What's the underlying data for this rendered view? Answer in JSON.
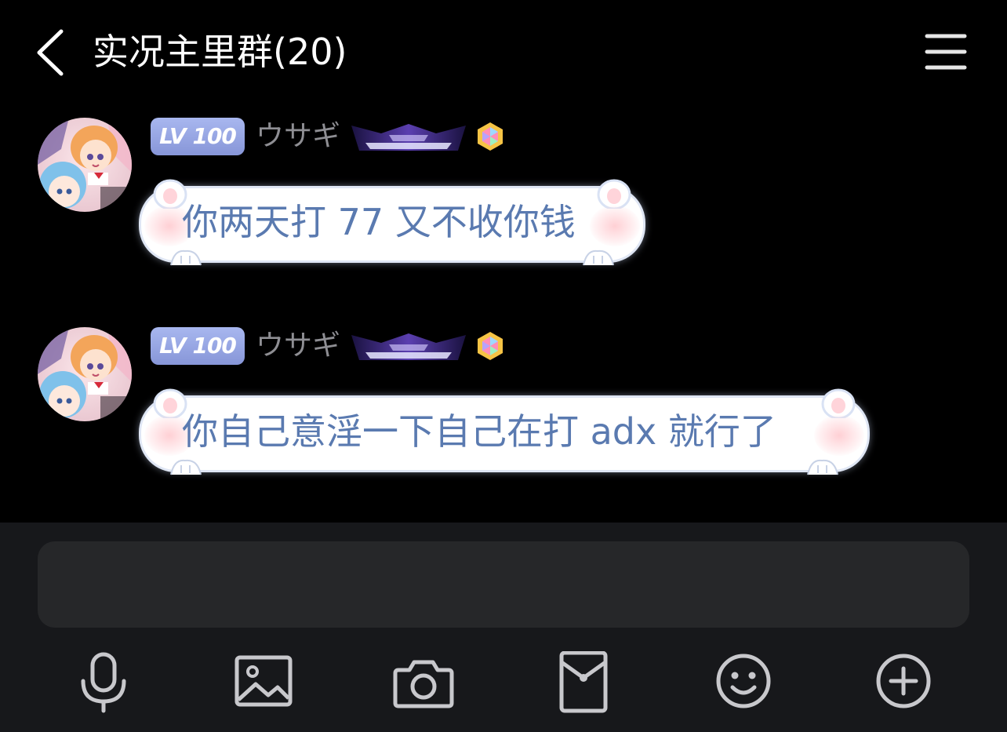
{
  "header": {
    "title": "实况主里群(20)",
    "back_icon": "chevron-left-icon",
    "menu_icon": "hamburger-menu-icon"
  },
  "messages": [
    {
      "level_badge": "LV 100",
      "username": "ウサギ",
      "text": "你两天打 77 又不收你钱"
    },
    {
      "level_badge": "LV 100",
      "username": "ウサギ",
      "text": "你自己意淫一下自己在打 adx 就行了"
    }
  ],
  "input": {
    "placeholder": ""
  },
  "toolbar": [
    {
      "icon": "microphone-icon"
    },
    {
      "icon": "image-icon"
    },
    {
      "icon": "camera-icon"
    },
    {
      "icon": "red-packet-icon"
    },
    {
      "icon": "emoji-icon"
    },
    {
      "icon": "plus-icon"
    }
  ],
  "colors": {
    "background": "#000000",
    "panel": "#17181b",
    "input": "#262729",
    "bubble_text": "#5a7ab0",
    "username": "#8e8e93",
    "badge": "#9aa9e6",
    "icon": "#c8c8cc"
  }
}
